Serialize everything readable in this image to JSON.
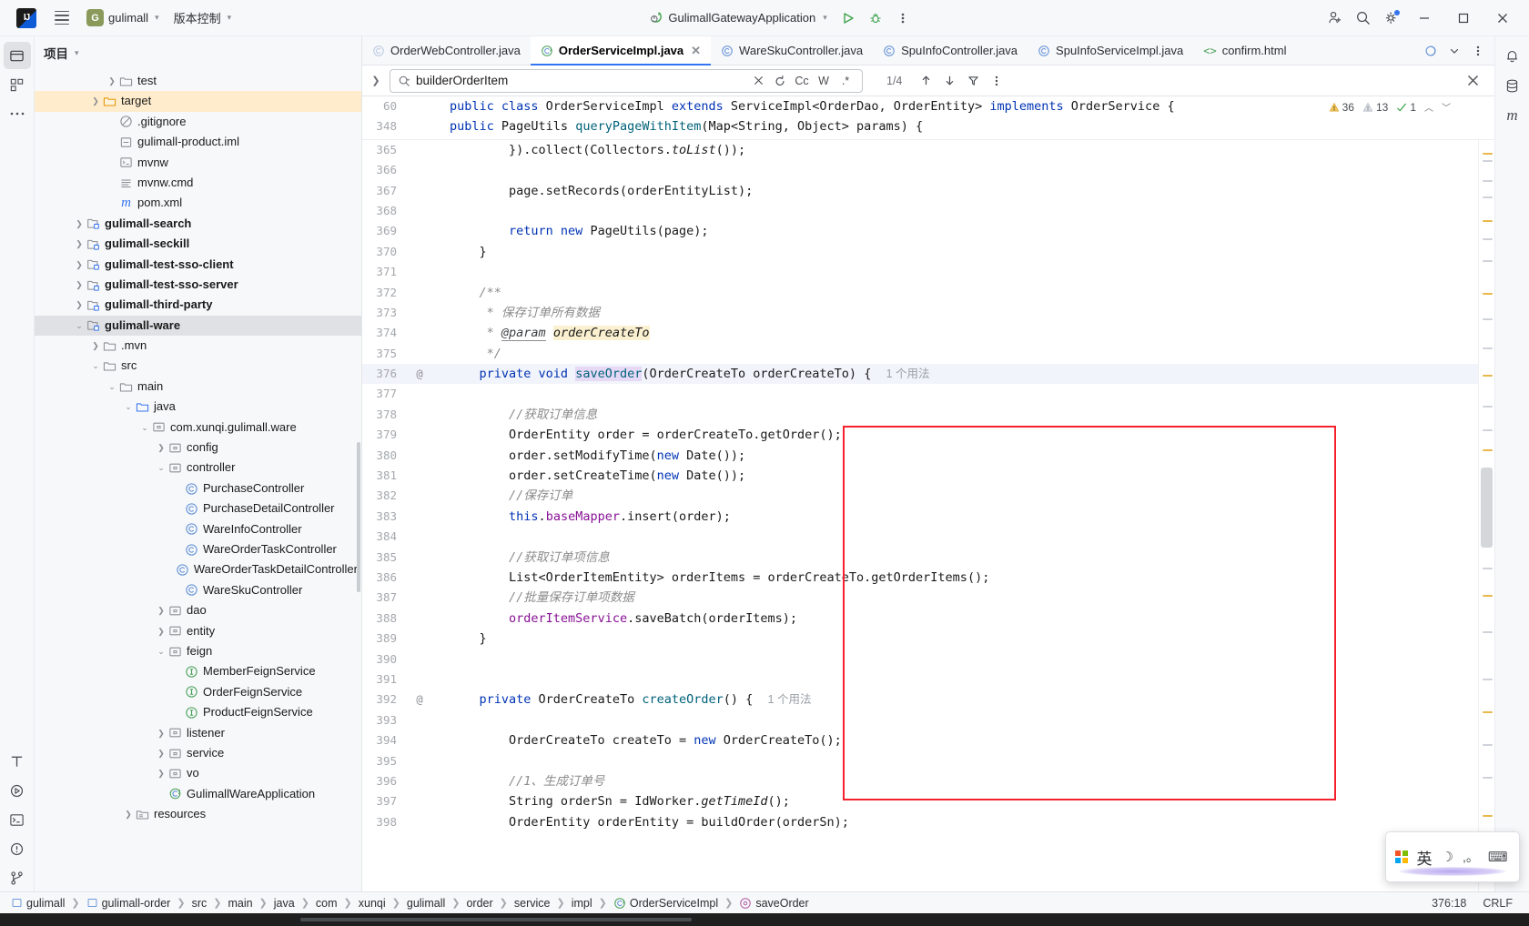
{
  "titlebar": {
    "logo": "IJ",
    "project_badge": "G",
    "project_name": "gulimall",
    "vcs_label": "版本控制",
    "run_config": "GulimallGatewayApplication",
    "icons": {
      "menu": "hamburger-icon",
      "run": "run-icon",
      "debug": "debug-icon",
      "more": "more-vertical-icon",
      "account": "account-add-icon",
      "search": "search-icon",
      "settings": "gear-icon",
      "minimize": "minimize-icon",
      "maximize": "maximize-icon",
      "close": "close-icon"
    }
  },
  "project_panel": {
    "title": "项目",
    "tree": [
      {
        "depth": 4,
        "arrow": "right",
        "icon": "folder",
        "label": "test",
        "bold": false,
        "sel": ""
      },
      {
        "depth": 3,
        "arrow": "right",
        "icon": "folder-amber",
        "label": "target",
        "bold": false,
        "sel": "amber"
      },
      {
        "depth": 4,
        "arrow": "none",
        "icon": "gitignore",
        "label": ".gitignore",
        "bold": false,
        "sel": ""
      },
      {
        "depth": 4,
        "arrow": "none",
        "icon": "iml",
        "label": "gulimall-product.iml",
        "bold": false,
        "sel": ""
      },
      {
        "depth": 4,
        "arrow": "none",
        "icon": "script",
        "label": "mvnw",
        "bold": false,
        "sel": ""
      },
      {
        "depth": 4,
        "arrow": "none",
        "icon": "text",
        "label": "mvnw.cmd",
        "bold": false,
        "sel": ""
      },
      {
        "depth": 4,
        "arrow": "none",
        "icon": "maven",
        "label": "pom.xml",
        "bold": false,
        "sel": ""
      },
      {
        "depth": 2,
        "arrow": "right",
        "icon": "module",
        "label": "gulimall-search",
        "bold": true,
        "sel": ""
      },
      {
        "depth": 2,
        "arrow": "right",
        "icon": "module",
        "label": "gulimall-seckill",
        "bold": true,
        "sel": ""
      },
      {
        "depth": 2,
        "arrow": "right",
        "icon": "module",
        "label": "gulimall-test-sso-client",
        "bold": true,
        "sel": ""
      },
      {
        "depth": 2,
        "arrow": "right",
        "icon": "module",
        "label": "gulimall-test-sso-server",
        "bold": true,
        "sel": ""
      },
      {
        "depth": 2,
        "arrow": "right",
        "icon": "module",
        "label": "gulimall-third-party",
        "bold": true,
        "sel": ""
      },
      {
        "depth": 2,
        "arrow": "down",
        "icon": "module",
        "label": "gulimall-ware",
        "bold": true,
        "sel": "gray"
      },
      {
        "depth": 3,
        "arrow": "right",
        "icon": "folder",
        "label": ".mvn",
        "bold": false,
        "sel": ""
      },
      {
        "depth": 3,
        "arrow": "down",
        "icon": "folder",
        "label": "src",
        "bold": false,
        "sel": ""
      },
      {
        "depth": 4,
        "arrow": "down",
        "icon": "folder",
        "label": "main",
        "bold": false,
        "sel": ""
      },
      {
        "depth": 5,
        "arrow": "down",
        "icon": "folder-src",
        "label": "java",
        "bold": false,
        "sel": ""
      },
      {
        "depth": 6,
        "arrow": "down",
        "icon": "package",
        "label": "com.xunqi.gulimall.ware",
        "bold": false,
        "sel": ""
      },
      {
        "depth": 7,
        "arrow": "right",
        "icon": "package",
        "label": "config",
        "bold": false,
        "sel": ""
      },
      {
        "depth": 7,
        "arrow": "down",
        "icon": "package",
        "label": "controller",
        "bold": false,
        "sel": ""
      },
      {
        "depth": 8,
        "arrow": "none",
        "icon": "class",
        "label": "PurchaseController",
        "bold": false,
        "sel": ""
      },
      {
        "depth": 8,
        "arrow": "none",
        "icon": "class",
        "label": "PurchaseDetailController",
        "bold": false,
        "sel": ""
      },
      {
        "depth": 8,
        "arrow": "none",
        "icon": "class",
        "label": "WareInfoController",
        "bold": false,
        "sel": ""
      },
      {
        "depth": 8,
        "arrow": "none",
        "icon": "class",
        "label": "WareOrderTaskController",
        "bold": false,
        "sel": ""
      },
      {
        "depth": 8,
        "arrow": "none",
        "icon": "class",
        "label": "WareOrderTaskDetailController",
        "bold": false,
        "sel": ""
      },
      {
        "depth": 8,
        "arrow": "none",
        "icon": "class",
        "label": "WareSkuController",
        "bold": false,
        "sel": ""
      },
      {
        "depth": 7,
        "arrow": "right",
        "icon": "package",
        "label": "dao",
        "bold": false,
        "sel": ""
      },
      {
        "depth": 7,
        "arrow": "right",
        "icon": "package",
        "label": "entity",
        "bold": false,
        "sel": ""
      },
      {
        "depth": 7,
        "arrow": "down",
        "icon": "package",
        "label": "feign",
        "bold": false,
        "sel": ""
      },
      {
        "depth": 8,
        "arrow": "none",
        "icon": "interface",
        "label": "MemberFeignService",
        "bold": false,
        "sel": ""
      },
      {
        "depth": 8,
        "arrow": "none",
        "icon": "interface",
        "label": "OrderFeignService",
        "bold": false,
        "sel": ""
      },
      {
        "depth": 8,
        "arrow": "none",
        "icon": "interface",
        "label": "ProductFeignService",
        "bold": false,
        "sel": ""
      },
      {
        "depth": 7,
        "arrow": "right",
        "icon": "package",
        "label": "listener",
        "bold": false,
        "sel": ""
      },
      {
        "depth": 7,
        "arrow": "right",
        "icon": "package",
        "label": "service",
        "bold": false,
        "sel": ""
      },
      {
        "depth": 7,
        "arrow": "right",
        "icon": "package",
        "label": "vo",
        "bold": false,
        "sel": ""
      },
      {
        "depth": 7,
        "arrow": "none",
        "icon": "springboot",
        "label": "GulimallWareApplication",
        "bold": false,
        "sel": ""
      },
      {
        "depth": 5,
        "arrow": "right",
        "icon": "resources",
        "label": "resources",
        "bold": false,
        "sel": ""
      }
    ]
  },
  "tabs": [
    {
      "label": "OrderWebController.java",
      "icon": "class-faded",
      "active": false,
      "closable": false
    },
    {
      "label": "OrderServiceImpl.java",
      "icon": "class-impl",
      "active": true,
      "closable": true
    },
    {
      "label": "WareSkuController.java",
      "icon": "class",
      "active": false,
      "closable": false
    },
    {
      "label": "SpuInfoController.java",
      "icon": "class",
      "active": false,
      "closable": false
    },
    {
      "label": "SpuInfoServiceImpl.java",
      "icon": "class",
      "active": false,
      "closable": false
    },
    {
      "label": "confirm.html",
      "icon": "html",
      "active": false,
      "closable": false
    }
  ],
  "search": {
    "value": "builderOrderItem",
    "placeholder": "",
    "match_count": "1/4",
    "toggles": [
      "Cc",
      "W",
      ".*"
    ],
    "icons": {
      "magnifier": "search-icon",
      "clear": "close-icon",
      "regex_history": "rotate-icon",
      "prev": "arrow-up-icon",
      "next": "arrow-down-icon",
      "filter": "filter-icon",
      "more": "more-vertical-icon",
      "close": "close-icon"
    }
  },
  "inspections": {
    "warnings": "36",
    "weak_warnings": "13",
    "typos": "1"
  },
  "sticky_lines": [
    {
      "num": "60",
      "indent": 4,
      "html": "<span class=\"kw\">public class</span> OrderServiceImpl <span class=\"kw\">extends</span> ServiceImpl&lt;OrderDao, OrderEntity&gt; <span class=\"kw\">implements</span> OrderService {"
    },
    {
      "num": "348",
      "indent": 6,
      "html": "<span class=\"kw\">public</span> PageUtils <span class=\"fn\">queryPageWithItem</span>(Map&lt;String, Object&gt; params) {"
    }
  ],
  "code_lines": [
    {
      "num": "365",
      "mark": "",
      "hl": false,
      "html": "        }).collect(Collectors.<span class=\"stat\">toList</span>());"
    },
    {
      "num": "366",
      "mark": "",
      "hl": false,
      "html": ""
    },
    {
      "num": "367",
      "mark": "",
      "hl": false,
      "html": "        page.setRecords(orderEntityList);"
    },
    {
      "num": "368",
      "mark": "",
      "hl": false,
      "html": ""
    },
    {
      "num": "369",
      "mark": "",
      "hl": false,
      "html": "        <span class=\"kw\">return new</span> PageUtils(page);"
    },
    {
      "num": "370",
      "mark": "",
      "hl": false,
      "html": "    }"
    },
    {
      "num": "371",
      "mark": "",
      "hl": false,
      "html": ""
    },
    {
      "num": "372",
      "mark": "",
      "hl": false,
      "html": "    <span class=\"cmt\">/**</span>"
    },
    {
      "num": "373",
      "mark": "",
      "hl": false,
      "html": "     <span class=\"cmt\">* 保存订单所有数据</span>"
    },
    {
      "num": "374",
      "mark": "",
      "hl": false,
      "html": "     <span class=\"cmt\">* </span><span class=\"param-link\">@param</span> <span class=\"hl-param\"><i>orderCreateTo</i></span>"
    },
    {
      "num": "375",
      "mark": "",
      "hl": false,
      "html": "     <span class=\"cmt\">*/</span>"
    },
    {
      "num": "376",
      "mark": "@",
      "hl": true,
      "html": "    <span class=\"kw\">private void</span> <span class=\"fn hl-ident\">saveOrder</span>(OrderCreateTo orderCreateTo) {  <span class=\"hint\">1 个用法</span>"
    },
    {
      "num": "377",
      "mark": "",
      "hl": false,
      "html": ""
    },
    {
      "num": "378",
      "mark": "",
      "hl": false,
      "html": "        <span class=\"cmt\">//获取订单信息</span>"
    },
    {
      "num": "379",
      "mark": "",
      "hl": false,
      "html": "        OrderEntity order = orderCreateTo.getOrder();"
    },
    {
      "num": "380",
      "mark": "",
      "hl": false,
      "html": "        order.setModifyTime(<span class=\"kw\">new</span> Date());"
    },
    {
      "num": "381",
      "mark": "",
      "hl": false,
      "html": "        order.setCreateTime(<span class=\"kw\">new</span> Date());"
    },
    {
      "num": "382",
      "mark": "",
      "hl": false,
      "html": "        <span class=\"cmt\">//保存订单</span>"
    },
    {
      "num": "383",
      "mark": "",
      "hl": false,
      "html": "        <span class=\"kw\">this</span>.<span class=\"fld\">baseMapper</span>.insert(order);"
    },
    {
      "num": "384",
      "mark": "",
      "hl": false,
      "html": ""
    },
    {
      "num": "385",
      "mark": "",
      "hl": false,
      "html": "        <span class=\"cmt\">//获取订单项信息</span>"
    },
    {
      "num": "386",
      "mark": "",
      "hl": false,
      "html": "        List&lt;OrderItemEntity&gt; orderItems = orderCreateTo.getOrderItems();"
    },
    {
      "num": "387",
      "mark": "",
      "hl": false,
      "html": "        <span class=\"cmt\">//批量保存订单项数据</span>"
    },
    {
      "num": "388",
      "mark": "",
      "hl": false,
      "html": "        <span class=\"fld\">orderItemService</span>.saveBatch(orderItems);"
    },
    {
      "num": "389",
      "mark": "",
      "hl": false,
      "html": "    }"
    },
    {
      "num": "390",
      "mark": "",
      "hl": false,
      "html": ""
    },
    {
      "num": "391",
      "mark": "",
      "hl": false,
      "html": ""
    },
    {
      "num": "392",
      "mark": "@",
      "hl": false,
      "html": "    <span class=\"kw\">private</span> OrderCreateTo <span class=\"fn\">createOrder</span>() {  <span class=\"hint\">1 个用法</span>"
    },
    {
      "num": "393",
      "mark": "",
      "hl": false,
      "html": ""
    },
    {
      "num": "394",
      "mark": "",
      "hl": false,
      "html": "        OrderCreateTo createTo = <span class=\"kw\">new</span> OrderCreateTo();"
    },
    {
      "num": "395",
      "mark": "",
      "hl": false,
      "html": ""
    },
    {
      "num": "396",
      "mark": "",
      "hl": false,
      "html": "        <span class=\"cmt\">//1、生成订单号</span>"
    },
    {
      "num": "397",
      "mark": "",
      "hl": false,
      "html": "        String orderSn = IdWorker.<span class=\"stat\">getTimeId</span>();"
    },
    {
      "num": "398",
      "mark": "",
      "hl": false,
      "html": "        OrderEntity orderEntity = buildOrder(orderSn);"
    }
  ],
  "breadcrumb": {
    "items": [
      {
        "label": "gulimall",
        "icon": "module"
      },
      {
        "label": "gulimall-order",
        "icon": "module"
      },
      {
        "label": "src",
        "icon": ""
      },
      {
        "label": "main",
        "icon": ""
      },
      {
        "label": "java",
        "icon": ""
      },
      {
        "label": "com",
        "icon": ""
      },
      {
        "label": "xunqi",
        "icon": ""
      },
      {
        "label": "gulimall",
        "icon": ""
      },
      {
        "label": "order",
        "icon": ""
      },
      {
        "label": "service",
        "icon": ""
      },
      {
        "label": "impl",
        "icon": ""
      },
      {
        "label": "OrderServiceImpl",
        "icon": "class-impl"
      },
      {
        "label": "saveOrder",
        "icon": "method"
      }
    ],
    "caret_position": "376:18",
    "line_separator": "CRLF"
  },
  "ime": {
    "lang": "英",
    "glyphs": [
      "moon-icon",
      "punctuation-icon",
      "keyboard-icon"
    ]
  },
  "colors": {
    "accent": "#3574f0",
    "annotation_box": "#f5222d",
    "run_green": "#3fa34d",
    "selection_amber": "#ffeccc",
    "selection_gray": "#dfe1e5"
  }
}
